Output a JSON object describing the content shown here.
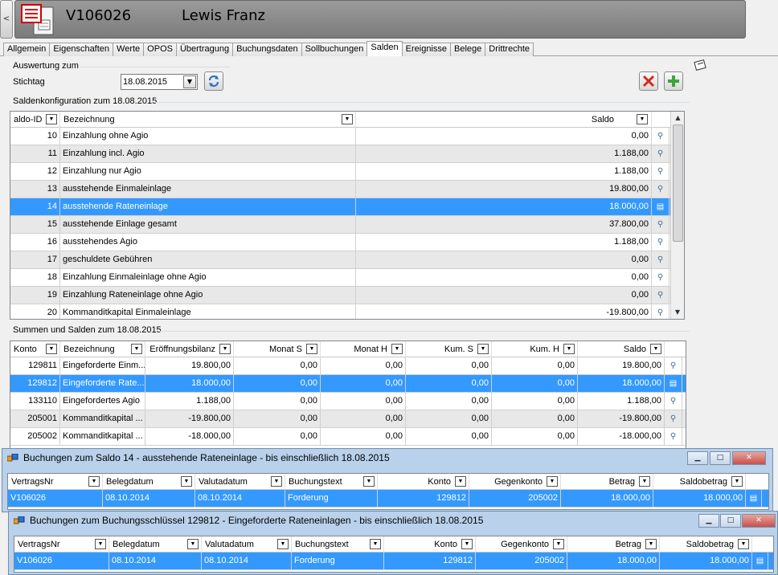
{
  "header": {
    "contract_id": "V106026",
    "client_name": "Lewis Franz",
    "collapse_glyph": "<"
  },
  "tabs": [
    {
      "label": "Allgemein"
    },
    {
      "label": "Eigenschaften"
    },
    {
      "label": "Werte"
    },
    {
      "label": "OPOS"
    },
    {
      "label": "Übertragung"
    },
    {
      "label": "Buchungsdaten"
    },
    {
      "label": "Sollbuchungen"
    },
    {
      "label": "Salden",
      "active": true
    },
    {
      "label": "Ereignisse"
    },
    {
      "label": "Belege"
    },
    {
      "label": "Drittrechte"
    }
  ],
  "evaluation": {
    "group_label": "Auswertung zum",
    "stichtag_label": "Stichtag",
    "date_value": "18.08.2015"
  },
  "saldo_config": {
    "group_label": "Saldenkonfiguration zum 18.08.2015",
    "headers": {
      "id": "aldo-ID",
      "name": "Bezeichnung",
      "saldo": "Saldo"
    },
    "rows": [
      {
        "id": "10",
        "name": "Einzahlung ohne Agio",
        "saldo": "0,00"
      },
      {
        "id": "11",
        "name": "Einzahlung incl. Agio",
        "saldo": "1.188,00"
      },
      {
        "id": "12",
        "name": "Einzahlung nur Agio",
        "saldo": "1.188,00"
      },
      {
        "id": "13",
        "name": "ausstehende Einmaleinlage",
        "saldo": "19.800,00"
      },
      {
        "id": "14",
        "name": "ausstehende Rateneinlage",
        "saldo": "18.000,00"
      },
      {
        "id": "15",
        "name": "ausstehende Einlage gesamt",
        "saldo": "37.800,00"
      },
      {
        "id": "16",
        "name": "ausstehendes Agio",
        "saldo": "1.188,00"
      },
      {
        "id": "17",
        "name": "geschuldete Gebühren",
        "saldo": "0,00"
      },
      {
        "id": "18",
        "name": "Einzahlung Einmaleinlage ohne Agio",
        "saldo": "0,00"
      },
      {
        "id": "19",
        "name": "Einzahlung Rateneinlage ohne Agio",
        "saldo": "0,00"
      },
      {
        "id": "20",
        "name": "Kommanditkapital Einmaleinlage",
        "saldo": "-19.800,00"
      }
    ],
    "selected_index": 4
  },
  "summen": {
    "group_label": "Summen und Salden zum 18.08.2015",
    "headers": [
      "Konto",
      "Bezeichnung",
      "Eröffnungsbilanz",
      "Monat S",
      "Monat H",
      "Kum. S",
      "Kum. H",
      "Saldo"
    ],
    "rows": [
      [
        "129811",
        "Eingeforderte Einm...",
        "19.800,00",
        "0,00",
        "0,00",
        "0,00",
        "0,00",
        "19.800,00"
      ],
      [
        "129812",
        "Eingeforderte Rate...",
        "18.000,00",
        "0,00",
        "0,00",
        "0,00",
        "0,00",
        "18.000,00"
      ],
      [
        "133110",
        "Eingefordertes Agio",
        "1.188,00",
        "0,00",
        "0,00",
        "0,00",
        "0,00",
        "1.188,00"
      ],
      [
        "205001",
        "Kommanditkapital ...",
        "-19.800,00",
        "0,00",
        "0,00",
        "0,00",
        "0,00",
        "-19.800,00"
      ],
      [
        "205002",
        "Kommanditkapital ...",
        "-18.000,00",
        "0,00",
        "0,00",
        "0,00",
        "0,00",
        "-18.000,00"
      ]
    ],
    "selected_index": 1
  },
  "dialog1": {
    "title": "Buchungen zum Saldo 14 - ausstehende Rateneinlage - bis einschließlich 18.08.2015",
    "headers": [
      "VertragsNr",
      "Belegdatum",
      "Valutadatum",
      "Buchungstext",
      "Konto",
      "Gegenkonto",
      "Betrag",
      "Saldobetrag"
    ],
    "row": [
      "V106026",
      "08.10.2014",
      "08.10.2014",
      "Forderung",
      "129812",
      "205002",
      "18.000,00",
      "18.000,00"
    ]
  },
  "dialog2": {
    "title": "Buchungen zum Buchungsschlüssel 129812 - Eingeforderte Rateneinlagen - bis einschließlich 18.08.2015",
    "headers": [
      "VertragsNr",
      "Belegdatum",
      "Valutadatum",
      "Buchungstext",
      "Konto",
      "Gegenkonto",
      "Betrag",
      "Saldobetrag"
    ],
    "row": [
      "V106026",
      "08.10.2014",
      "08.10.2014",
      "Forderung",
      "129812",
      "205002",
      "18.000,00",
      "18.000,00"
    ]
  },
  "icons": {
    "refresh": "refresh-icon",
    "delete": "delete-icon",
    "add": "add-icon",
    "note": "note-icon",
    "magnifier": "magnifier-icon",
    "document": "document-icon"
  },
  "colors": {
    "selection": "#3399ff",
    "header_bar": "#8a8a8a",
    "dialog_frame": "#b9d1ea"
  }
}
